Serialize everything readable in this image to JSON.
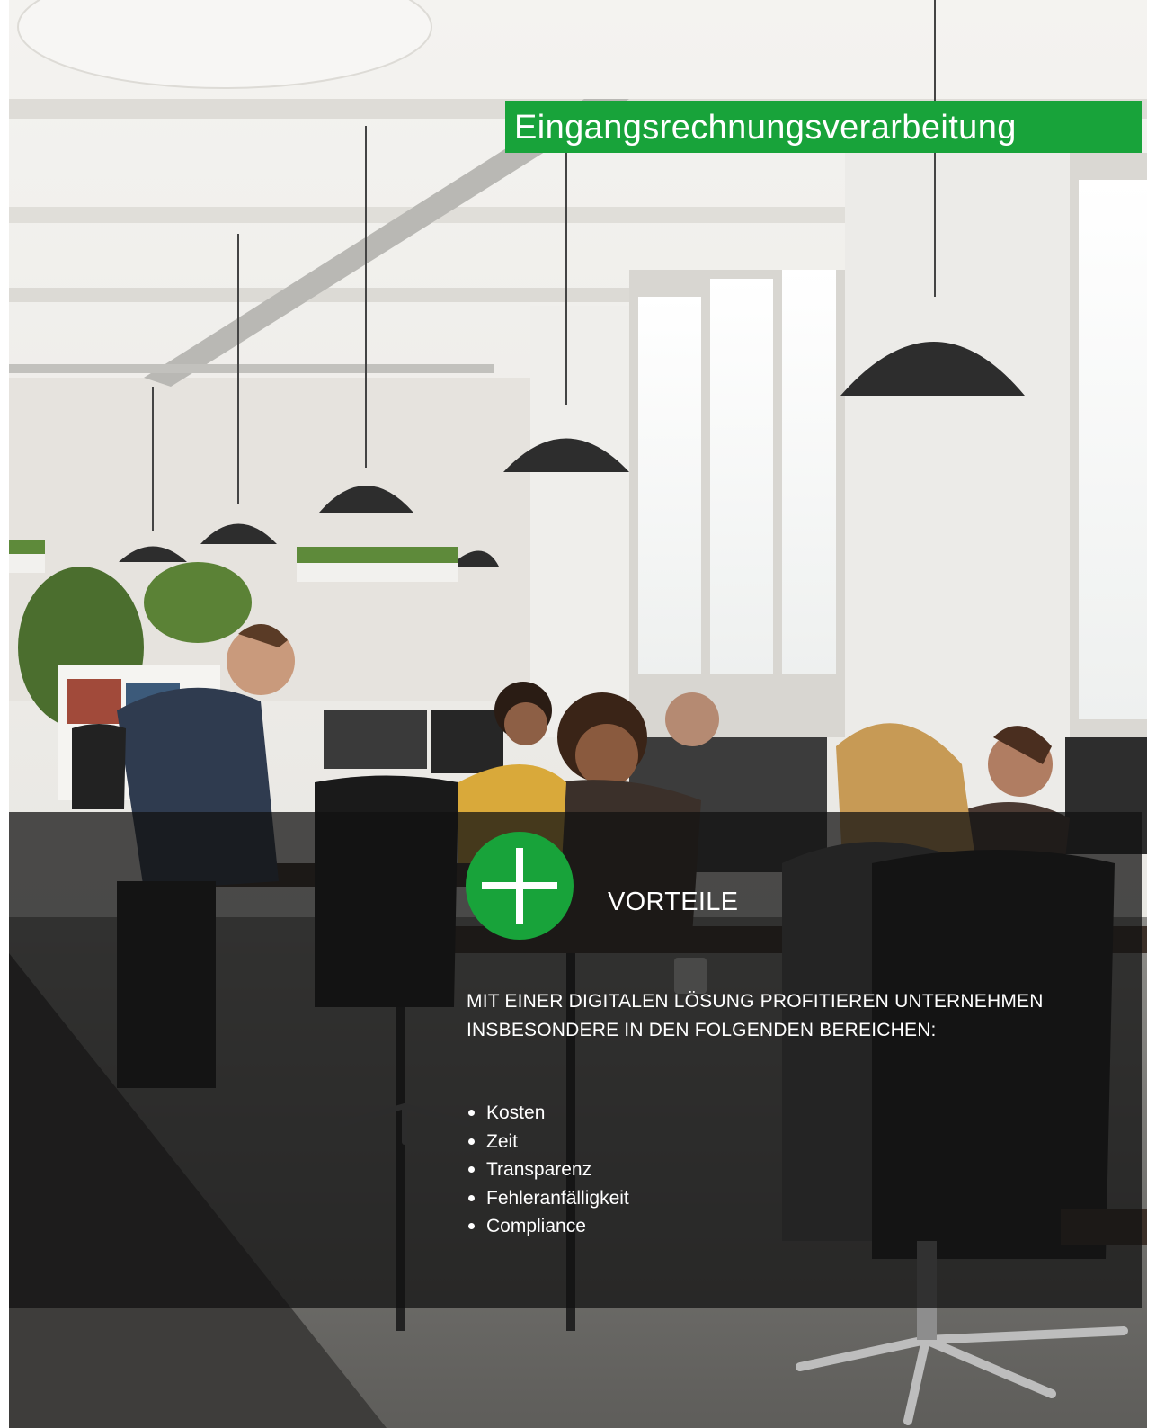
{
  "header": {
    "title": "Eingangsrechnungsverarbeitung"
  },
  "benefits_panel": {
    "icon": "plus-circle-icon",
    "heading": "VORTEILE",
    "intro": "MIT EINER DIGITALEN LÖSUNG PROFITIEREN UNTERNEHMEN INSBESONDERE IN DEN FOLGENDEN BEREICHEN:",
    "items": [
      "Kosten",
      "Zeit",
      "Transparenz",
      "Fehleranfälligkeit",
      "Compliance"
    ]
  },
  "colors": {
    "accent_green": "#18a33a",
    "overlay": "#121212",
    "text": "#ffffff"
  }
}
